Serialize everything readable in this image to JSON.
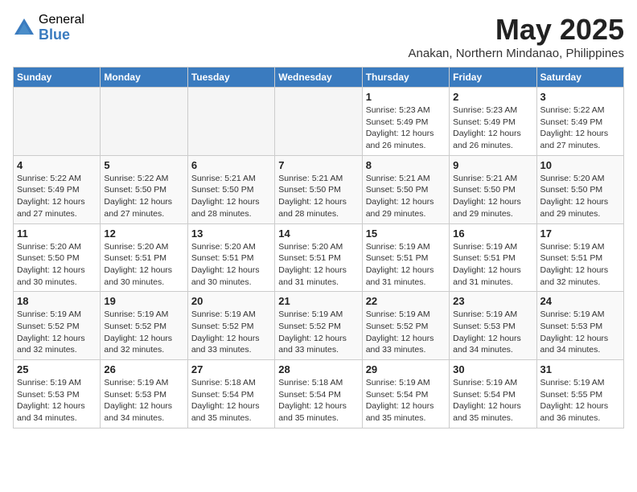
{
  "logo": {
    "general": "General",
    "blue": "Blue"
  },
  "title": "May 2025",
  "subtitle": "Anakan, Northern Mindanao, Philippines",
  "days_of_week": [
    "Sunday",
    "Monday",
    "Tuesday",
    "Wednesday",
    "Thursday",
    "Friday",
    "Saturday"
  ],
  "weeks": [
    [
      {
        "day": "",
        "info": ""
      },
      {
        "day": "",
        "info": ""
      },
      {
        "day": "",
        "info": ""
      },
      {
        "day": "",
        "info": ""
      },
      {
        "day": "1",
        "info": "Sunrise: 5:23 AM\nSunset: 5:49 PM\nDaylight: 12 hours\nand 26 minutes."
      },
      {
        "day": "2",
        "info": "Sunrise: 5:23 AM\nSunset: 5:49 PM\nDaylight: 12 hours\nand 26 minutes."
      },
      {
        "day": "3",
        "info": "Sunrise: 5:22 AM\nSunset: 5:49 PM\nDaylight: 12 hours\nand 27 minutes."
      }
    ],
    [
      {
        "day": "4",
        "info": "Sunrise: 5:22 AM\nSunset: 5:49 PM\nDaylight: 12 hours\nand 27 minutes."
      },
      {
        "day": "5",
        "info": "Sunrise: 5:22 AM\nSunset: 5:50 PM\nDaylight: 12 hours\nand 27 minutes."
      },
      {
        "day": "6",
        "info": "Sunrise: 5:21 AM\nSunset: 5:50 PM\nDaylight: 12 hours\nand 28 minutes."
      },
      {
        "day": "7",
        "info": "Sunrise: 5:21 AM\nSunset: 5:50 PM\nDaylight: 12 hours\nand 28 minutes."
      },
      {
        "day": "8",
        "info": "Sunrise: 5:21 AM\nSunset: 5:50 PM\nDaylight: 12 hours\nand 29 minutes."
      },
      {
        "day": "9",
        "info": "Sunrise: 5:21 AM\nSunset: 5:50 PM\nDaylight: 12 hours\nand 29 minutes."
      },
      {
        "day": "10",
        "info": "Sunrise: 5:20 AM\nSunset: 5:50 PM\nDaylight: 12 hours\nand 29 minutes."
      }
    ],
    [
      {
        "day": "11",
        "info": "Sunrise: 5:20 AM\nSunset: 5:50 PM\nDaylight: 12 hours\nand 30 minutes."
      },
      {
        "day": "12",
        "info": "Sunrise: 5:20 AM\nSunset: 5:51 PM\nDaylight: 12 hours\nand 30 minutes."
      },
      {
        "day": "13",
        "info": "Sunrise: 5:20 AM\nSunset: 5:51 PM\nDaylight: 12 hours\nand 30 minutes."
      },
      {
        "day": "14",
        "info": "Sunrise: 5:20 AM\nSunset: 5:51 PM\nDaylight: 12 hours\nand 31 minutes."
      },
      {
        "day": "15",
        "info": "Sunrise: 5:19 AM\nSunset: 5:51 PM\nDaylight: 12 hours\nand 31 minutes."
      },
      {
        "day": "16",
        "info": "Sunrise: 5:19 AM\nSunset: 5:51 PM\nDaylight: 12 hours\nand 31 minutes."
      },
      {
        "day": "17",
        "info": "Sunrise: 5:19 AM\nSunset: 5:51 PM\nDaylight: 12 hours\nand 32 minutes."
      }
    ],
    [
      {
        "day": "18",
        "info": "Sunrise: 5:19 AM\nSunset: 5:52 PM\nDaylight: 12 hours\nand 32 minutes."
      },
      {
        "day": "19",
        "info": "Sunrise: 5:19 AM\nSunset: 5:52 PM\nDaylight: 12 hours\nand 32 minutes."
      },
      {
        "day": "20",
        "info": "Sunrise: 5:19 AM\nSunset: 5:52 PM\nDaylight: 12 hours\nand 33 minutes."
      },
      {
        "day": "21",
        "info": "Sunrise: 5:19 AM\nSunset: 5:52 PM\nDaylight: 12 hours\nand 33 minutes."
      },
      {
        "day": "22",
        "info": "Sunrise: 5:19 AM\nSunset: 5:52 PM\nDaylight: 12 hours\nand 33 minutes."
      },
      {
        "day": "23",
        "info": "Sunrise: 5:19 AM\nSunset: 5:53 PM\nDaylight: 12 hours\nand 34 minutes."
      },
      {
        "day": "24",
        "info": "Sunrise: 5:19 AM\nSunset: 5:53 PM\nDaylight: 12 hours\nand 34 minutes."
      }
    ],
    [
      {
        "day": "25",
        "info": "Sunrise: 5:19 AM\nSunset: 5:53 PM\nDaylight: 12 hours\nand 34 minutes."
      },
      {
        "day": "26",
        "info": "Sunrise: 5:19 AM\nSunset: 5:53 PM\nDaylight: 12 hours\nand 34 minutes."
      },
      {
        "day": "27",
        "info": "Sunrise: 5:18 AM\nSunset: 5:54 PM\nDaylight: 12 hours\nand 35 minutes."
      },
      {
        "day": "28",
        "info": "Sunrise: 5:18 AM\nSunset: 5:54 PM\nDaylight: 12 hours\nand 35 minutes."
      },
      {
        "day": "29",
        "info": "Sunrise: 5:19 AM\nSunset: 5:54 PM\nDaylight: 12 hours\nand 35 minutes."
      },
      {
        "day": "30",
        "info": "Sunrise: 5:19 AM\nSunset: 5:54 PM\nDaylight: 12 hours\nand 35 minutes."
      },
      {
        "day": "31",
        "info": "Sunrise: 5:19 AM\nSunset: 5:55 PM\nDaylight: 12 hours\nand 36 minutes."
      }
    ]
  ]
}
